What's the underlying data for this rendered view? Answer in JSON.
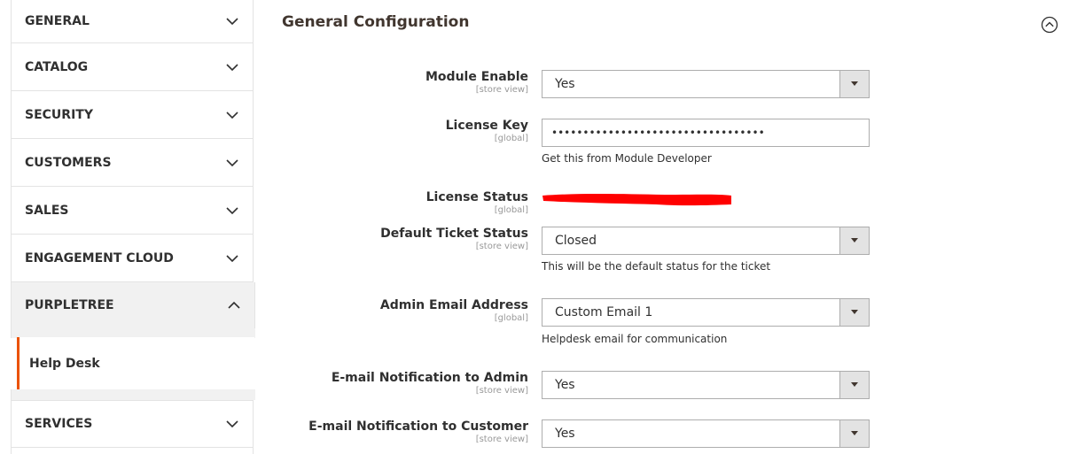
{
  "sidebar": {
    "sections": [
      {
        "label": "GENERAL",
        "expanded": false
      },
      {
        "label": "CATALOG",
        "expanded": false
      },
      {
        "label": "SECURITY",
        "expanded": false
      },
      {
        "label": "CUSTOMERS",
        "expanded": false
      },
      {
        "label": "SALES",
        "expanded": false
      },
      {
        "label": "ENGAGEMENT CLOUD",
        "expanded": false
      },
      {
        "label": "PURPLETREE",
        "expanded": true
      },
      {
        "label": "SERVICES",
        "expanded": false
      }
    ],
    "active_item": {
      "label": "Help Desk"
    },
    "accent_color": "#eb5202"
  },
  "main": {
    "title": "General Configuration",
    "fields": [
      {
        "label": "Module Enable",
        "scope": "[store view]",
        "type": "select",
        "value": "Yes"
      },
      {
        "label": "License Key",
        "scope": "[global]",
        "type": "password",
        "value": "••••••••••••••••••••••••••••••••••",
        "note": "Get this from Module Developer"
      },
      {
        "label": "License Status",
        "scope": "[global]",
        "type": "redacted",
        "redaction_color": "#ff0000"
      },
      {
        "label": "Default Ticket Status",
        "scope": "[store view]",
        "type": "select",
        "value": "Closed",
        "note": "This will be the default status for the ticket"
      },
      {
        "label": "Admin Email Address",
        "scope": "[global]",
        "type": "select",
        "value": "Custom Email 1",
        "note": "Helpdesk email for communication"
      },
      {
        "label": "E-mail Notification to Admin",
        "scope": "[store view]",
        "type": "select",
        "value": "Yes"
      },
      {
        "label": "E-mail Notification to Customer",
        "scope": "[store view]",
        "type": "select",
        "value": "Yes"
      }
    ]
  },
  "icons": {
    "section_toggle": "chevron-down-icon",
    "section_toggle_open": "chevron-up-icon",
    "collapse": "circle-chevron-up-icon",
    "select_arrow": "caret-down-icon"
  }
}
